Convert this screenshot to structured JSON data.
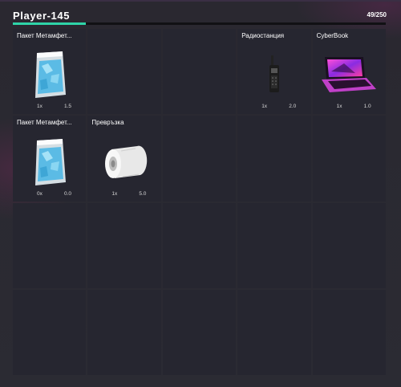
{
  "inventory": {
    "title": "Player-145",
    "capacity": "49/250",
    "weight_fraction": 0.196
  },
  "slots": [
    {
      "label": "Пакет Метамфет...",
      "count": "1x",
      "weight": "1.5",
      "icon": "meth-bag-icon"
    },
    {
      "label": "",
      "count": "",
      "weight": ""
    },
    {
      "label": "",
      "count": "",
      "weight": ""
    },
    {
      "label": "Радиостанция",
      "count": "1x",
      "weight": "2.0",
      "icon": "radio-icon"
    },
    {
      "label": "CyberBook",
      "count": "1x",
      "weight": "1.0",
      "icon": "laptop-icon"
    },
    {
      "label": "Пакет Метамфет...",
      "count": "0x",
      "weight": "0.0",
      "icon": "meth-bag-icon"
    },
    {
      "label": "Превръзка",
      "count": "1x",
      "weight": "5.0",
      "icon": "bandage-icon"
    }
  ],
  "colors": {
    "accent": "#2fd4a8",
    "background": "#2c2b33",
    "slot": "#262630"
  }
}
